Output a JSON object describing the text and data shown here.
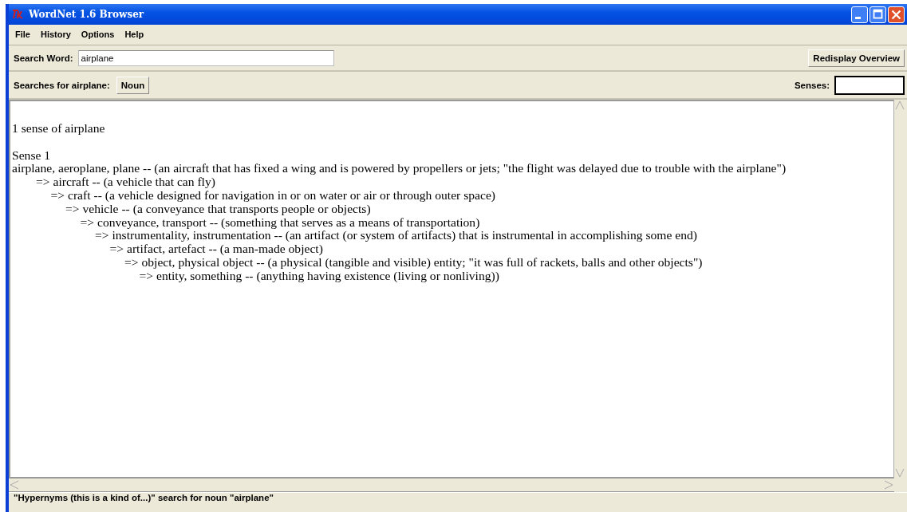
{
  "window": {
    "title": "WordNet 1.6 Browser"
  },
  "menu": [
    "File",
    "History",
    "Options",
    "Help"
  ],
  "search": {
    "label": "Search Word:",
    "value": "airplane",
    "button": "Redisplay Overview"
  },
  "searches": {
    "label": "Searches for airplane:",
    "buttons": [
      "Noun"
    ],
    "senses_label": "Senses:"
  },
  "results": {
    "summary": "1 sense of airplane",
    "senses": [
      {
        "label": "Sense 1",
        "entry": {
          "text": "airplane, aeroplane, plane -- (an aircraft that has fixed a wing and is powered by propellers or jets; \"the flight was delayed due to trouble with the airplane\")",
          "children": [
            {
              "text": "=> aircraft -- (a vehicle that can fly)",
              "children": [
                {
                  "text": "=> craft -- (a vehicle designed for navigation in or on water or air or through outer space)",
                  "children": [
                    {
                      "text": "=> vehicle -- (a conveyance that transports people or objects)",
                      "children": [
                        {
                          "text": "=> conveyance, transport -- (something that serves as a means of transportation)",
                          "children": [
                            {
                              "text": "=> instrumentality, instrumentation -- (an artifact (or system of artifacts) that is instrumental in accomplishing some end)",
                              "children": [
                                {
                                  "text": "=> artifact, artefact -- (a man-made object)",
                                  "children": [
                                    {
                                      "text": "=> object, physical object -- (a physical (tangible and visible) entity; \"it was full of rackets, balls and other objects\")",
                                      "children": [
                                        {
                                          "text": "=> entity, something -- (anything having existence (living or nonliving))"
                                        }
                                      ]
                                    }
                                  ]
                                }
                              ]
                            }
                          ]
                        }
                      ]
                    }
                  ]
                }
              ]
            }
          ]
        }
      }
    ]
  },
  "status_bar": "\"Hypernyms (this is a kind of...)\" search for noun \"airplane\""
}
